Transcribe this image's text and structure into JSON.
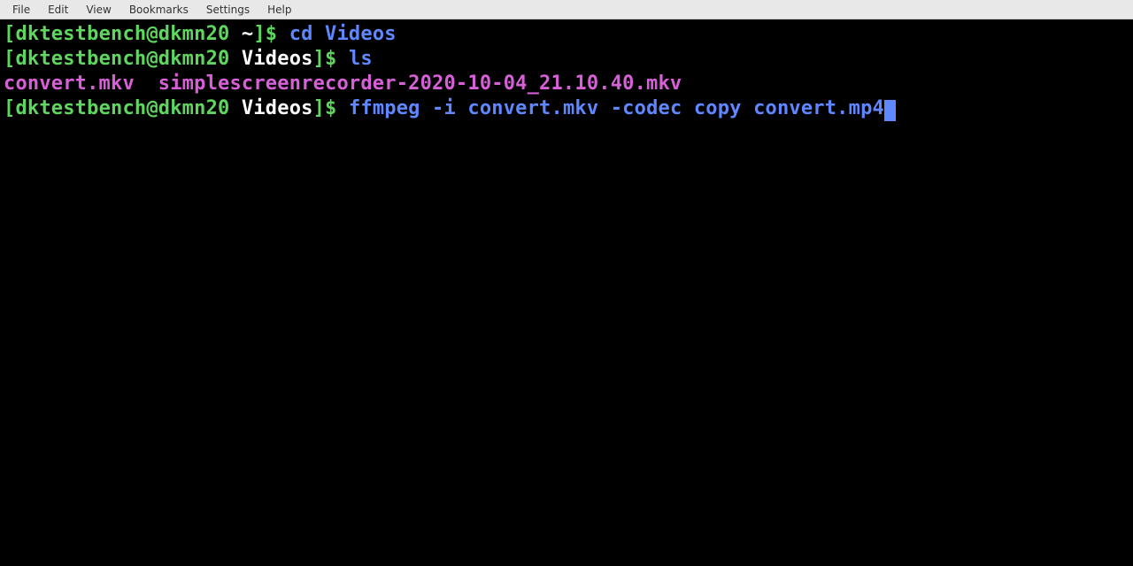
{
  "menubar": {
    "items": [
      "File",
      "Edit",
      "View",
      "Bookmarks",
      "Settings",
      "Help"
    ]
  },
  "terminal": {
    "user_host": "dktestbench@dkmn20",
    "lines": [
      {
        "prompt_open": "[",
        "user_host": "dktestbench@dkmn20",
        "cwd": " ~",
        "prompt_close": "]$ ",
        "command": "cd Videos"
      },
      {
        "prompt_open": "[",
        "user_host": "dktestbench@dkmn20",
        "cwd": " Videos",
        "prompt_close": "]$ ",
        "command": "ls"
      }
    ],
    "ls_output": {
      "file1": "convert.mkv",
      "spacer": "  ",
      "file2": "simplescreenrecorder-2020-10-04_21.10.40.mkv"
    },
    "current_line": {
      "prompt_open": "[",
      "user_host": "dktestbench@dkmn20",
      "cwd": " Videos",
      "prompt_close": "]$ ",
      "command": "ffmpeg -i convert.mkv -codec copy convert.mp4"
    }
  }
}
